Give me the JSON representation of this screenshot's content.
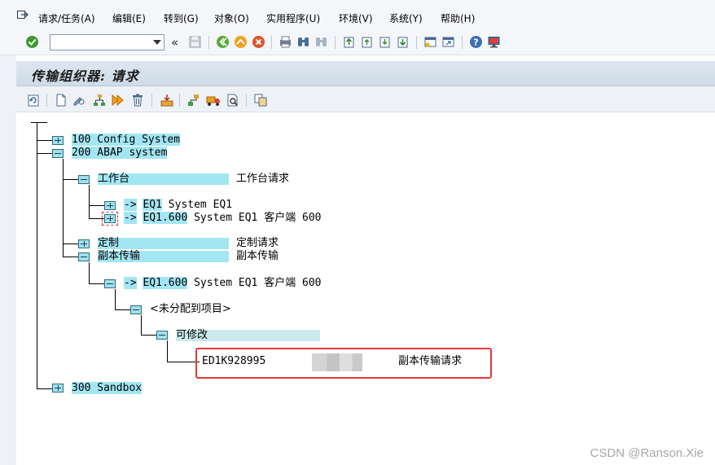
{
  "menubar": {
    "icon": "menu-exit-icon",
    "items": [
      "请求/任务(A)",
      "编辑(E)",
      "转到(G)",
      "对象(O)",
      "实用程序(U)",
      "环境(V)",
      "系统(Y)",
      "帮助(H)"
    ]
  },
  "toolbar": {
    "command_value": "",
    "back_glyph": "«"
  },
  "title": "传输组织器: 请求",
  "tree": {
    "clients": [
      {
        "label": "100 Config System"
      },
      {
        "label": "200 ABAP system"
      },
      {
        "label": "300 Sandbox"
      }
    ],
    "workbench": {
      "label": "工作台",
      "desc": "工作台请求"
    },
    "workbench_targets": [
      {
        "arrow": "->",
        "code": "EQ1",
        "desc": "System EQ1"
      },
      {
        "arrow": "->",
        "code": "EQ1.600",
        "desc": "System EQ1 客户端 600"
      }
    ],
    "customizing": {
      "label": "定制",
      "desc": "定制请求"
    },
    "transport_copy": {
      "label": "副本传输",
      "desc": "副本传输"
    },
    "copy_target": {
      "arrow": "->",
      "code": "EQ1.600",
      "desc": "System EQ1 客户端 600"
    },
    "unassigned": {
      "label": "<未分配到项目>"
    },
    "modifiable": {
      "label": "可修改"
    },
    "request": {
      "id": "ED1K928995",
      "desc": "副本传输请求"
    }
  },
  "watermark": "CSDN @Ranson.Xie",
  "colors": {
    "node_highlight": "#a3e6f3",
    "frame_bg": "#f4f6fa",
    "annotation_red": "#e53935"
  }
}
